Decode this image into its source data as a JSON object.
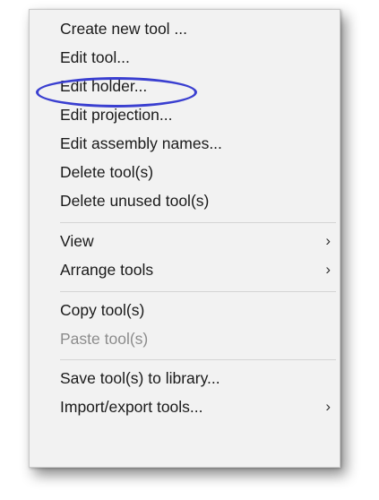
{
  "menu": {
    "items": [
      {
        "label": "Create new tool ...",
        "submenu": false,
        "disabled": false
      },
      {
        "label": "Edit tool...",
        "submenu": false,
        "disabled": false
      },
      {
        "label": "Edit holder...",
        "submenu": false,
        "disabled": false
      },
      {
        "label": "Edit projection...",
        "submenu": false,
        "disabled": false
      },
      {
        "label": "Edit assembly names...",
        "submenu": false,
        "disabled": false
      },
      {
        "label": "Delete tool(s)",
        "submenu": false,
        "disabled": false
      },
      {
        "label": "Delete unused tool(s)",
        "submenu": false,
        "disabled": false
      },
      {
        "label": "View",
        "submenu": true,
        "disabled": false
      },
      {
        "label": "Arrange tools",
        "submenu": true,
        "disabled": false
      },
      {
        "label": "Copy tool(s)",
        "submenu": false,
        "disabled": false
      },
      {
        "label": "Paste tool(s)",
        "submenu": false,
        "disabled": true
      },
      {
        "label": "Save tool(s) to library...",
        "submenu": false,
        "disabled": false
      },
      {
        "label": "Import/export tools...",
        "submenu": true,
        "disabled": false
      }
    ],
    "chevron_glyph": "›",
    "highlighted_item": "Edit holder...",
    "highlight_color": "#3a3fd0"
  }
}
